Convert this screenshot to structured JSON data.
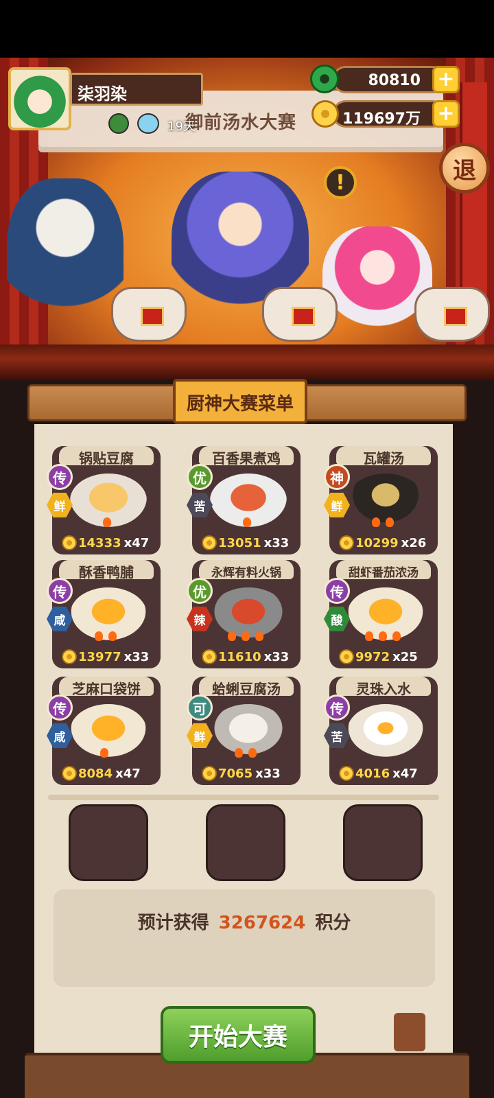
{
  "player": {
    "name": "柒羽染",
    "days": "19天"
  },
  "currency": {
    "jade": "80810",
    "gold": "119697万",
    "plus_label": "+"
  },
  "stage": {
    "banner_title": "御前汤水大赛",
    "alert_label": "!",
    "retreat_label": "退"
  },
  "menu": {
    "title": "厨神大赛菜单",
    "dishes": [
      {
        "name": "锅贴豆腐",
        "quality": "传",
        "taste": "鲜",
        "price": "14333",
        "count": "x47"
      },
      {
        "name": "百香果煮鸡",
        "quality": "优",
        "taste": "苦",
        "price": "13051",
        "count": "x33"
      },
      {
        "name": "瓦罐汤",
        "quality": "神",
        "taste": "鲜",
        "price": "10299",
        "count": "x26"
      },
      {
        "name": "酥香鸭脯",
        "quality": "传",
        "taste": "咸",
        "price": "13977",
        "count": "x33"
      },
      {
        "name": "永辉有料火锅",
        "quality": "优",
        "taste": "辣",
        "price": "11610",
        "count": "x33"
      },
      {
        "name": "甜虾番茄浓汤",
        "quality": "传",
        "taste": "酸",
        "price": "9972",
        "count": "x25"
      },
      {
        "name": "芝麻口袋饼",
        "quality": "传",
        "taste": "咸",
        "price": "8084",
        "count": "x47"
      },
      {
        "name": "蛤蜊豆腐汤",
        "quality": "可",
        "taste": "鲜",
        "price": "7065",
        "count": "x33"
      },
      {
        "name": "灵珠入水",
        "quality": "传",
        "taste": "苦",
        "price": "4016",
        "count": "x47"
      }
    ]
  },
  "estimate": {
    "prefix": "预计获得",
    "points": "3267624",
    "suffix": "积分"
  },
  "start_button": "开始大赛",
  "colors": {
    "accent_orange": "#d1541d",
    "start_green": "#4f9e2c",
    "card_bg": "#4c3434",
    "paper": "#eadfca"
  }
}
